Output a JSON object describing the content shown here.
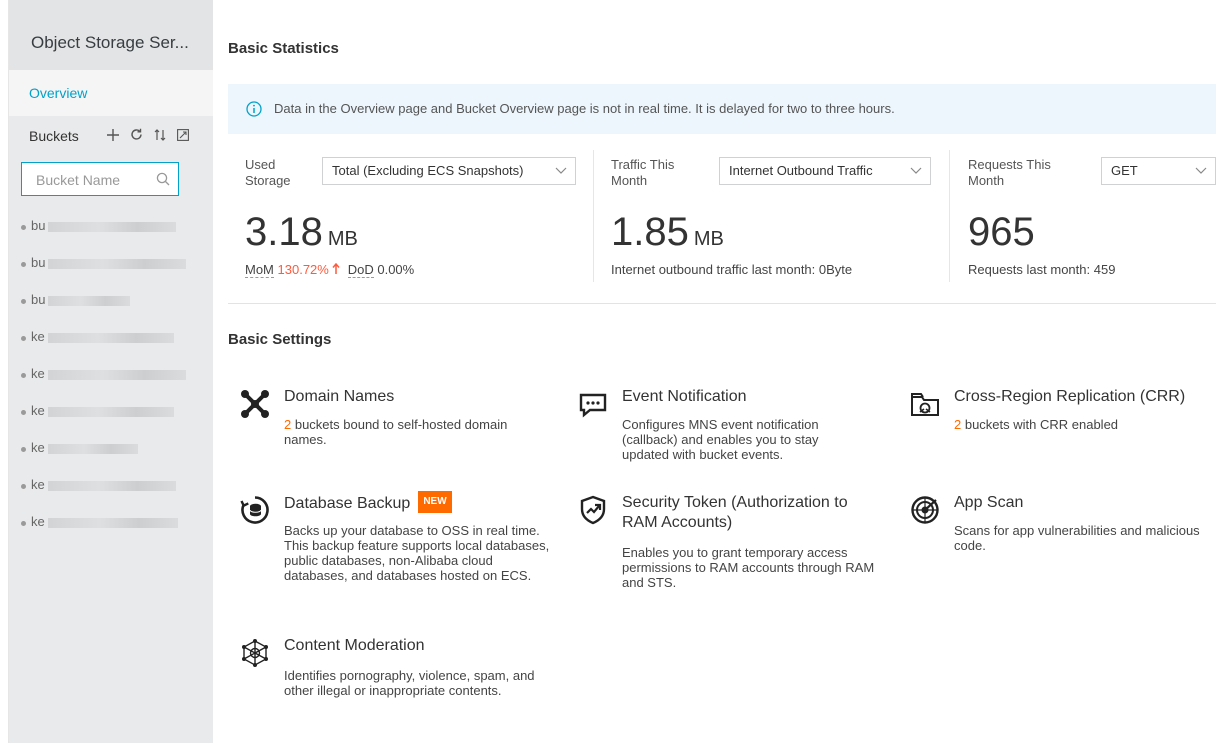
{
  "sidebar": {
    "title": "Object Storage Ser...",
    "overview": "Overview",
    "buckets_label": "Buckets",
    "search_placeholder": "Bucket Name",
    "bucket_prefixes": [
      "bu",
      "bu",
      "bu",
      "ke",
      "ke",
      "ke",
      "ke",
      "ke",
      "ke"
    ]
  },
  "basic_statistics": {
    "title": "Basic Statistics",
    "notice": "Data in the Overview page and Bucket Overview page is not in real time. It is delayed for two to three hours.",
    "used_storage": {
      "label_line1": "Used",
      "label_line2": "Storage",
      "select": "Total (Excluding ECS Snapshots)",
      "value": "3.18",
      "unit": "MB",
      "mom_label": "MoM",
      "mom_value": "130.72%",
      "dod_label": "DoD",
      "dod_value": "0.00%"
    },
    "traffic": {
      "label_line1": "Traffic This",
      "label_line2": "Month",
      "select": "Internet Outbound Traffic",
      "value": "1.85",
      "unit": "MB",
      "sub": "Internet outbound traffic last month: 0Byte"
    },
    "requests": {
      "label_line1": "Requests This",
      "label_line2": "Month",
      "select": "GET",
      "value": "965",
      "sub": "Requests last month: 459"
    }
  },
  "basic_settings": {
    "title": "Basic Settings",
    "domain": {
      "title": "Domain Names",
      "count": "2",
      "desc_rest": " buckets bound to self-hosted domain names."
    },
    "event": {
      "title": "Event Notification",
      "desc": "Configures MNS event notification (callback) and enables you to stay updated with bucket events."
    },
    "crr": {
      "title": "Cross-Region Replication (CRR)",
      "count": "2",
      "desc_rest": " buckets with CRR enabled"
    },
    "backup": {
      "title": "Database Backup",
      "badge": "NEW",
      "desc": "Backs up your database to OSS in real time. This backup feature supports local databases, public databases, non-Alibaba cloud databases, and databases hosted on ECS."
    },
    "sts": {
      "title_line1": "Security Token (Authorization to",
      "title_line2": "RAM Accounts)",
      "desc": "Enables you to grant temporary access permissions to RAM accounts through RAM and STS."
    },
    "appscan": {
      "title": "App Scan",
      "desc": "Scans for app vulnerabilities and malicious code."
    },
    "moderation": {
      "title": "Content Moderation",
      "desc": "Identifies pornography, violence, spam, and other illegal or inappropriate contents."
    }
  },
  "colors": {
    "accent": "#00a2ca",
    "orange": "#ff6a00",
    "red": "#ff5a3c",
    "notice_bg": "#ecf6fc"
  },
  "icons": [
    "info-icon",
    "search-icon",
    "plus-icon",
    "refresh-icon",
    "sort-icon",
    "expand-icon",
    "domain-icon",
    "event-icon",
    "crr-icon",
    "database-icon",
    "security-icon",
    "appscan-icon",
    "moderation-icon"
  ]
}
